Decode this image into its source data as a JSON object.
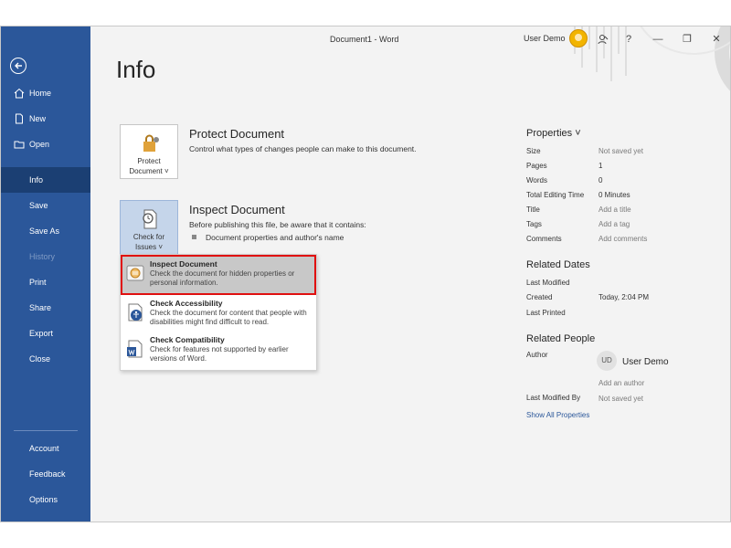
{
  "titlebar": {
    "doc_title": "Document1  -  Word",
    "user_name": "User Demo",
    "icons": [
      "avatar",
      "coauth-icon",
      "help-icon",
      "minimize-icon",
      "restore-icon",
      "close-icon"
    ]
  },
  "sidebar": {
    "back": "back-arrow-icon",
    "items": [
      {
        "label": "Home",
        "icon": "home-icon"
      },
      {
        "label": "New",
        "icon": "new-doc-icon"
      },
      {
        "label": "Open",
        "icon": "folder-icon"
      },
      {
        "label": "Info",
        "active": true
      },
      {
        "label": "Save"
      },
      {
        "label": "Save As"
      },
      {
        "label": "History",
        "disabled": true
      },
      {
        "label": "Print"
      },
      {
        "label": "Share"
      },
      {
        "label": "Export"
      },
      {
        "label": "Close"
      }
    ],
    "bottom": [
      {
        "label": "Account"
      },
      {
        "label": "Feedback"
      },
      {
        "label": "Options"
      }
    ]
  },
  "main": {
    "title": "Info",
    "protect": {
      "button_line1": "Protect",
      "button_line2": "Document ˅",
      "title": "Protect Document",
      "desc": "Control what types of changes people can make to this document."
    },
    "inspect": {
      "button_line1": "Check for",
      "button_line2": "Issues ˅",
      "title": "Inspect Document",
      "desc": "Before publishing this file, be aware that it contains:",
      "bullet": "Document properties and author's name"
    },
    "dropdown": [
      {
        "title": "Inspect Document",
        "desc": "Check the document for hidden properties or personal information.",
        "icon": "inspect-icon"
      },
      {
        "title": "Check Accessibility",
        "desc": "Check the document for content that people with disabilities might find difficult to read.",
        "icon": "accessibility-icon"
      },
      {
        "title": "Check Compatibility",
        "desc": "Check for features not supported by earlier versions of Word.",
        "icon": "compatibility-icon"
      }
    ]
  },
  "properties": {
    "header": "Properties ˅",
    "rows": [
      {
        "label": "Size",
        "value": "Not saved yet"
      },
      {
        "label": "Pages",
        "value": "1"
      },
      {
        "label": "Words",
        "value": "0"
      },
      {
        "label": "Total Editing Time",
        "value": "0 Minutes"
      },
      {
        "label": "Title",
        "value": "Add a title"
      },
      {
        "label": "Tags",
        "value": "Add a tag"
      },
      {
        "label": "Comments",
        "value": "Add comments"
      }
    ],
    "dates_header": "Related Dates",
    "dates": [
      {
        "label": "Last Modified",
        "value": ""
      },
      {
        "label": "Created",
        "value": "Today, 2:04 PM"
      },
      {
        "label": "Last Printed",
        "value": ""
      }
    ],
    "people_header": "Related People",
    "author_label": "Author",
    "author_initials": "UD",
    "author_name": "User Demo",
    "add_author": "Add an author",
    "last_modified_by_label": "Last Modified By",
    "last_modified_by_value": "Not saved yet",
    "show_all": "Show All Properties"
  },
  "colors": {
    "sidebar": "#2b579a",
    "sidebar_active": "#1b3f73",
    "highlight_frame": "#e01010"
  }
}
